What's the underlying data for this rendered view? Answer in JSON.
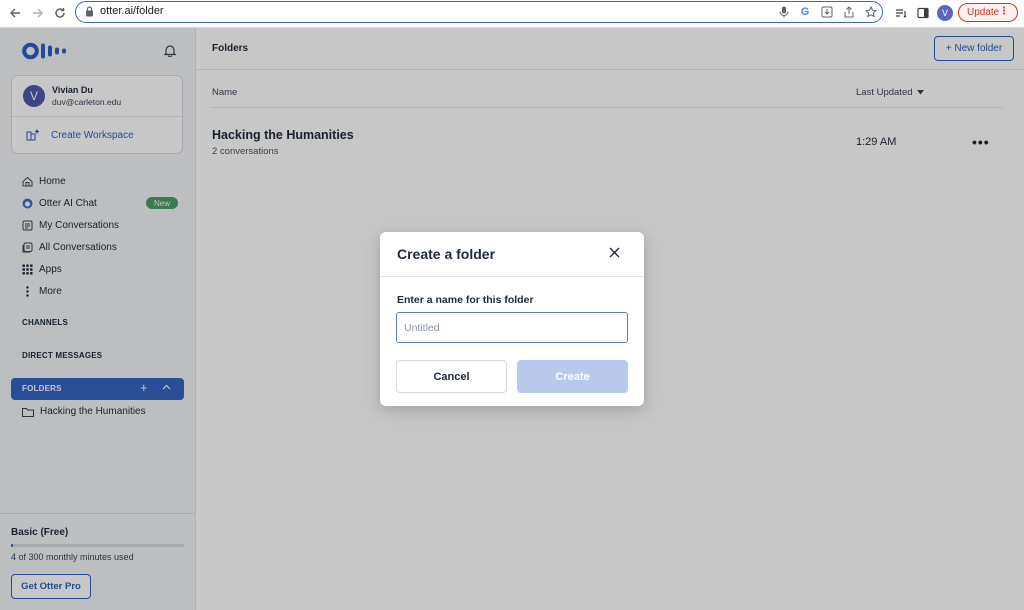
{
  "browser": {
    "url": "otter.ai/folder",
    "profile_initial": "V",
    "update_label": "Update"
  },
  "app": {
    "user": {
      "initial": "V",
      "name": "Vivian Du",
      "email": "duv@carleton.edu"
    },
    "create_workspace": "Create Workspace",
    "nav": [
      {
        "label": "Home",
        "icon": "home-icon"
      },
      {
        "label": "Otter AI Chat",
        "icon": "otter-chat-icon",
        "badge": "New"
      },
      {
        "label": "My Conversations",
        "icon": "conversations-icon"
      },
      {
        "label": "All Conversations",
        "icon": "all-conversations-icon"
      },
      {
        "label": "Apps",
        "icon": "apps-grid-icon"
      },
      {
        "label": "More",
        "icon": "more-vertical-icon"
      }
    ],
    "channels_label": "CHANNELS",
    "dm_label": "DIRECT MESSAGES",
    "folders_label": "FOLDERS",
    "folders": [
      {
        "name": "Hacking the Humanities"
      }
    ],
    "plan": {
      "name": "Basic (Free)",
      "usage": "4 of 300 monthly minutes used",
      "used": 4,
      "total": 300,
      "cta": "Get Otter Pro"
    }
  },
  "main": {
    "title": "Folders",
    "new_folder_label": "+ New folder",
    "columns": {
      "name": "Name",
      "updated": "Last Updated"
    },
    "rows": [
      {
        "title": "Hacking the Humanities",
        "subtitle": "2 conversations",
        "time": "1:29 AM",
        "more": "•••"
      }
    ]
  },
  "modal": {
    "title": "Create a folder",
    "label": "Enter a name for this folder",
    "placeholder": "Untitled",
    "cancel": "Cancel",
    "create": "Create"
  },
  "colors": {
    "accent": "#2f5fc4",
    "sidebar_bg": "#f2f4f7",
    "badge_green": "#4a9e69",
    "update_red": "#d93025"
  }
}
